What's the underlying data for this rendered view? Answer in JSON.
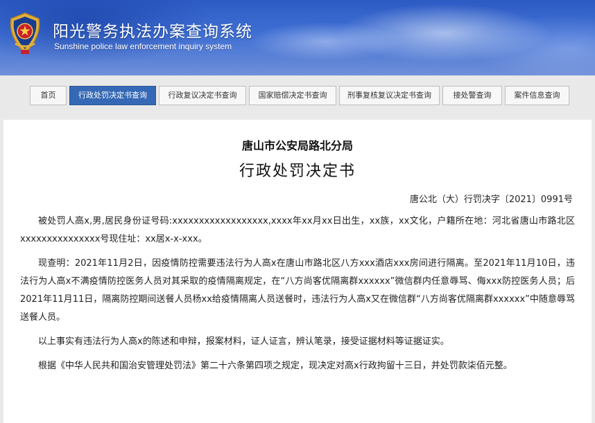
{
  "header": {
    "title": "阳光警务执法办案查询系统",
    "subtitle": "Sunshine police law enforcement inquiry system"
  },
  "nav": {
    "items": [
      {
        "label": "首页"
      },
      {
        "label": "行政处罚决定书查询"
      },
      {
        "label": "行政复议决定书查询"
      },
      {
        "label": "国家赔偿决定书查询"
      },
      {
        "label": "刑事复核复议决定书查询"
      },
      {
        "label": "接处警查询"
      },
      {
        "label": "案件信息查询"
      }
    ],
    "active_index": 1
  },
  "document": {
    "office": "唐山市公安局路北分局",
    "title": "行政处罚决定书",
    "number": "唐公北（大）行罚决字〔2021〕0991号",
    "paragraphs": [
      "被处罚人高x,男,居民身份证号码:xxxxxxxxxxxxxxxxxx,xxxx年xx月xx日出生，xx族，xx文化，户籍所在地：河北省唐山市路北区xxxxxxxxxxxxxxx号现住址：xx居x-x-xxx。",
      "现查明：2021年11月2日，因疫情防控需要违法行为人高x在唐山市路北区八方xxx酒店xxx房间进行隔离。至2021年11月10日，违法行为人高x不满疫情防控医务人员对其采取的疫情隔离规定，在“八方尚客优隔离群xxxxxx”微信群内任意辱骂、侮xxx防控医务人员；后2021年11月11日，隔离防控期间送餐人员杨xx给疫情隔离人员送餐时，违法行为人高x又在微信群“八方尚客优隔离群xxxxxx”中随意辱骂送餐人员。",
      "以上事实有违法行为人高x的陈述和申辩，报案材料，证人证言，辨认笔录，接受证据材料等证据证实。",
      "根据《中华人民共和国治安管理处罚法》第二十六条第四项之规定，现决定对高x行政拘留十三日，并处罚款柒佰元整。"
    ]
  },
  "colors": {
    "banner_blue": "#3f6fd3",
    "nav_active": "#3569b5",
    "page_bg": "#e9e9e9"
  },
  "icons": {
    "logo": "police-emblem-icon"
  }
}
